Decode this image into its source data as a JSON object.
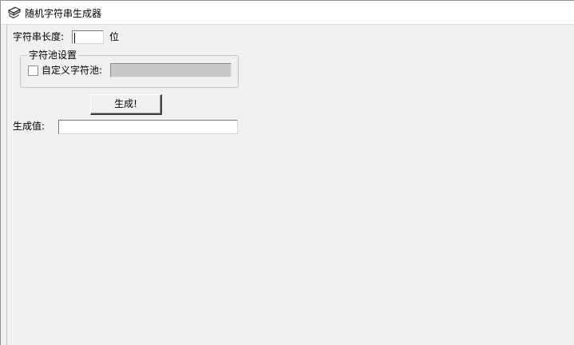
{
  "window": {
    "title": "随机字符串生成器",
    "icon": "app-icon"
  },
  "length": {
    "label": "字符串长度:",
    "value": "",
    "unit": "位"
  },
  "pool_group": {
    "title": "字符池设置",
    "custom_checkbox_label": "自定义字符池:",
    "custom_checked": false,
    "custom_value": ""
  },
  "generate_button": {
    "label": "生成!"
  },
  "result": {
    "label": "生成值:",
    "value": ""
  },
  "colors": {
    "window_bg": "#f0f0f0",
    "disabled_field": "#c8c8c8",
    "titlebar_bg": "#ffffff"
  }
}
